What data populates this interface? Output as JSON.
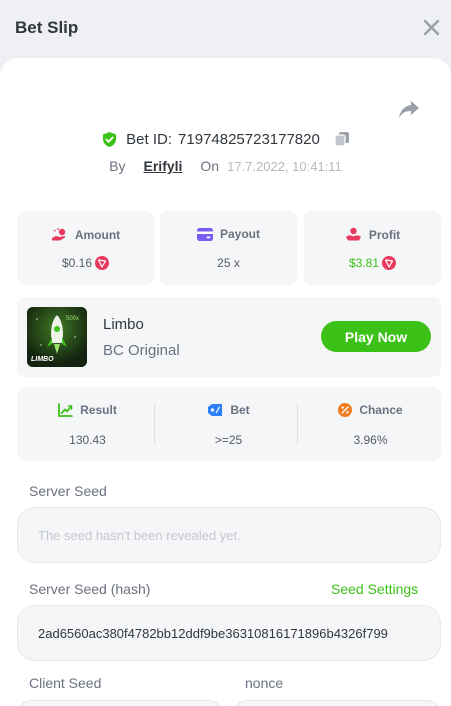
{
  "header": {
    "title": "Bet Slip"
  },
  "bet": {
    "id_label": "Bet ID:",
    "id": "71974825723177820",
    "by_label": "By",
    "user": "Erifyli",
    "on_label": "On",
    "date": "17.7.2022, 10:41:11"
  },
  "stats": {
    "amount": {
      "label": "Amount",
      "value": "$0.16"
    },
    "payout": {
      "label": "Payout",
      "value": "25 x"
    },
    "profit": {
      "label": "Profit",
      "value": "$3.81"
    }
  },
  "game": {
    "name": "Limbo",
    "subtitle": "BC Original",
    "thumb_text": "LIMBO",
    "play_label": "Play Now"
  },
  "result": {
    "result": {
      "label": "Result",
      "value": "130.43"
    },
    "bet": {
      "label": "Bet",
      "value": ">=25"
    },
    "chance": {
      "label": "Chance",
      "value": "3.96%"
    }
  },
  "seeds": {
    "server_seed_label": "Server Seed",
    "server_seed_placeholder": "The seed hasn't been revealed yet.",
    "server_hash_label": "Server Seed (hash)",
    "seed_settings_label": "Seed Settings",
    "server_hash_value": "2ad6560ac380f4782bb12ddf9be36310816171896b4326f799",
    "client_seed_label": "Client Seed",
    "nonce_label": "nonce"
  },
  "colors": {
    "accent_green": "#3bc117",
    "coin_red": "#e83a5f",
    "background": "#eef0f3"
  }
}
